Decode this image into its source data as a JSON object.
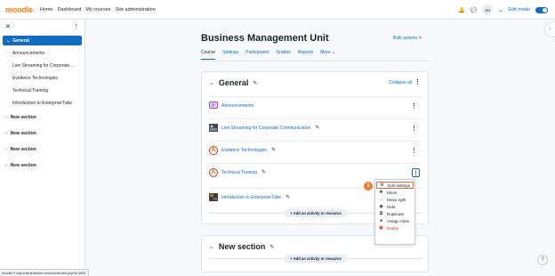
{
  "navbar": {
    "logo": "moodle",
    "links": [
      "Home",
      "Dashboard",
      "My courses",
      "Site administration"
    ],
    "avatar": "AU",
    "edit_mode_label": "Edit mode"
  },
  "drawer": {
    "active_section": "General",
    "items": [
      "Announcements",
      "Live Streaming for Corporate...",
      "Evidence Technologies",
      "Technical Training",
      "Introduction to EnterpriseTube"
    ],
    "sections": [
      "New section",
      "New section",
      "New section",
      "New section"
    ]
  },
  "main": {
    "title": "Business Management Unit",
    "bulk_actions": "Bulk actions",
    "tabs": [
      "Course",
      "Settings",
      "Participants",
      "Grades",
      "Reports",
      "More"
    ],
    "general": {
      "title": "General",
      "collapse_all": "Collapse all",
      "activities": [
        {
          "label": "Announcements",
          "icon": "forum-icon"
        },
        {
          "label": "Live Streaming for Corporate Communication",
          "icon": "video-thumbnail"
        },
        {
          "label": "Evidence Technologies",
          "icon": "url-icon"
        },
        {
          "label": "Technical Training",
          "icon": "url-icon"
        },
        {
          "label": "Introduction to EnterpriseTube",
          "icon": "video-thumbnail"
        }
      ],
      "add_label": "+ Add an activity or resource"
    },
    "new_section": {
      "title": "New section",
      "add_label": "+ Add an activity or resource"
    }
  },
  "menu": {
    "items": [
      "Edit settings",
      "Move",
      "Move right",
      "Hide",
      "Duplicate",
      "Assign roles",
      "Delete"
    ]
  },
  "step_badge": "1",
  "status_url": "moodle.f7.wdp.enterprisetube.com/course/view.php?id=2699",
  "colors": {
    "brand": "#f98012",
    "link": "#0f6cbf",
    "danger": "#ca3120",
    "highlight": "#e06c3d"
  }
}
